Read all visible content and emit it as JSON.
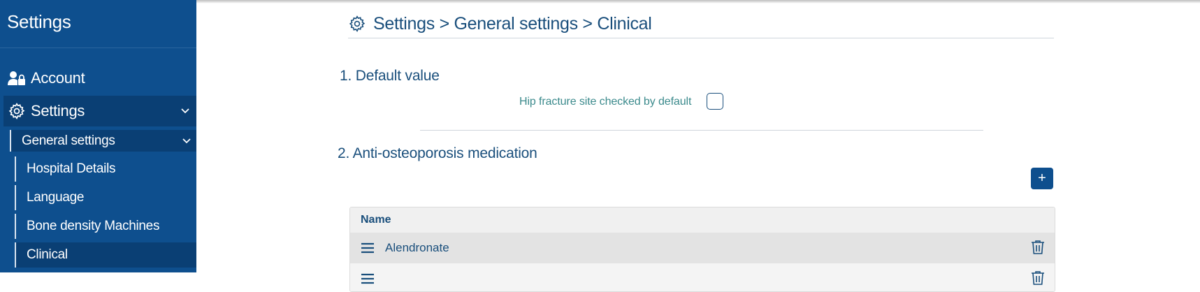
{
  "sidebar": {
    "title": "Settings",
    "account_label": "Account",
    "settings_label": "Settings",
    "general_label": "General settings",
    "items": [
      {
        "label": "Hospital Details"
      },
      {
        "label": "Language"
      },
      {
        "label": "Bone density Machines"
      },
      {
        "label": "Clinical"
      }
    ]
  },
  "header": {
    "breadcrumb": "Settings > General settings > Clinical"
  },
  "sections": {
    "default_value": {
      "title": "1. Default value",
      "checkbox_label": "Hip fracture site checked by default",
      "checked": false
    },
    "medication": {
      "title": "2. Anti-osteoporosis medication",
      "add_label": "+",
      "table": {
        "column_name": "Name",
        "rows": [
          {
            "name": "Alendronate"
          },
          {
            "name": ""
          }
        ]
      }
    }
  },
  "colors": {
    "sidebar_bg": "#0e4f8e",
    "sidebar_active": "#0a3f74",
    "text_primary": "#1a4f7c",
    "label_teal": "#3b8a8c"
  }
}
